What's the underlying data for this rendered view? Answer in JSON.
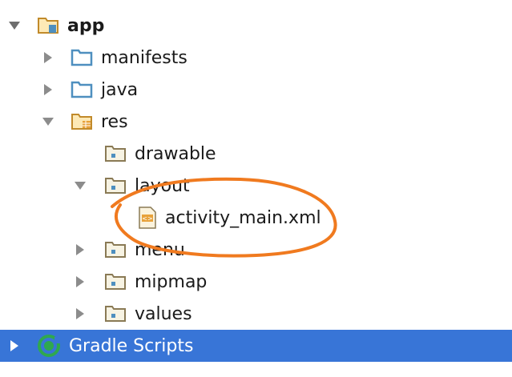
{
  "project_tree": {
    "items": [
      {
        "label": "app",
        "icon": "module-folder-icon",
        "expanded": true
      },
      {
        "label": "manifests",
        "icon": "folder-icon",
        "expanded": false
      },
      {
        "label": "java",
        "icon": "folder-icon",
        "expanded": false
      },
      {
        "label": "res",
        "icon": "resource-folder-icon",
        "expanded": true
      },
      {
        "label": "drawable",
        "icon": "folder-icon"
      },
      {
        "label": "layout",
        "icon": "folder-icon",
        "expanded": true
      },
      {
        "label": "activity_main.xml",
        "icon": "xml-file-icon"
      },
      {
        "label": "menu",
        "icon": "folder-icon",
        "expanded": false
      },
      {
        "label": "mipmap",
        "icon": "folder-icon",
        "expanded": false
      },
      {
        "label": "values",
        "icon": "folder-icon",
        "expanded": false
      },
      {
        "label": "Gradle Scripts",
        "icon": "gradle-icon",
        "expanded": false,
        "selected": true
      }
    ]
  },
  "colors": {
    "selection": "#3875d7",
    "annotation": "#f07a1f",
    "folder": "#4e8fbf"
  }
}
